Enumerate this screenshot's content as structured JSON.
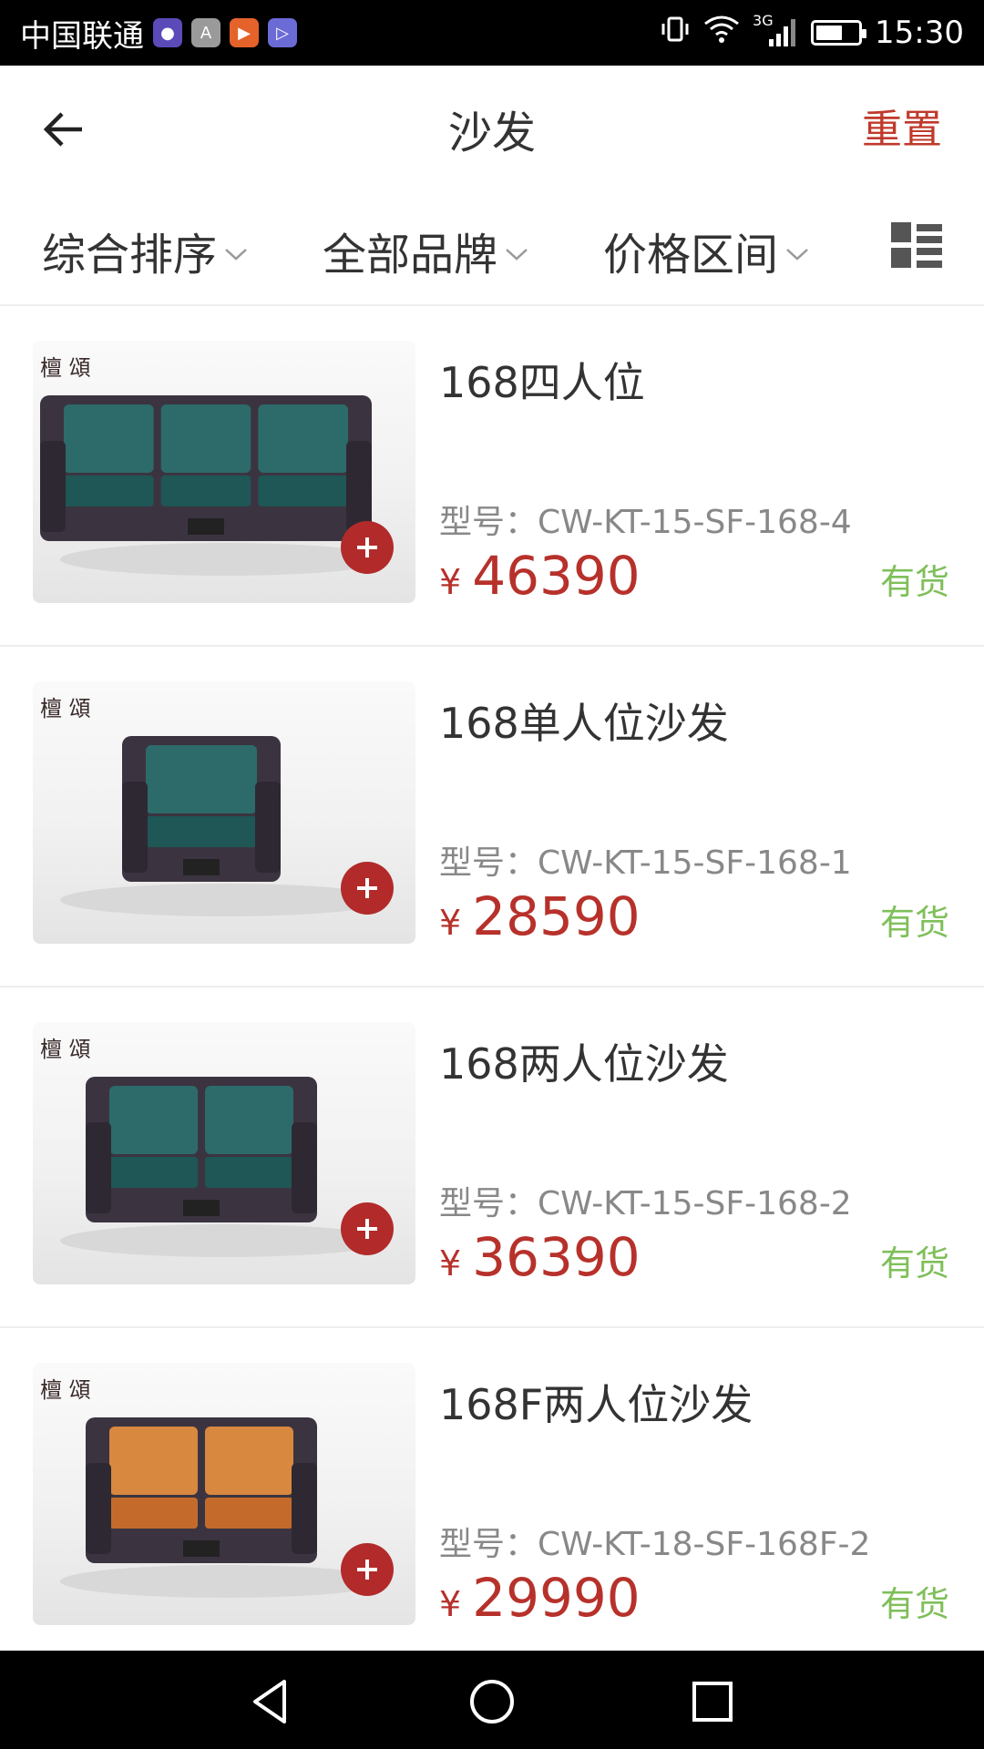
{
  "status_bar": {
    "carrier": "中国联通",
    "network": "3G",
    "time": "15:30",
    "badges": [
      "chat-app-icon",
      "text-app-icon",
      "video-app-icon",
      "play-app-icon"
    ]
  },
  "header": {
    "title": "沙发",
    "reset_label": "重置"
  },
  "filters": {
    "sort_label": "综合排序",
    "brand_label": "全部品牌",
    "price_label": "价格区间"
  },
  "colors": {
    "accent": "#b7312b",
    "stock": "#7fbf5a",
    "add_button": "#b22a2a"
  },
  "products": [
    {
      "name": "168四人位",
      "model": "型号：CW-KT-15-SF-168-4",
      "currency": "¥",
      "price": "46390",
      "stock": "有货",
      "color": "teal",
      "seats": 3
    },
    {
      "name": "168单人位沙发",
      "model": "型号：CW-KT-15-SF-168-1",
      "currency": "¥",
      "price": "28590",
      "stock": "有货",
      "color": "teal",
      "seats": 1
    },
    {
      "name": "168两人位沙发",
      "model": "型号：CW-KT-15-SF-168-2",
      "currency": "¥",
      "price": "36390",
      "stock": "有货",
      "color": "teal",
      "seats": 2
    },
    {
      "name": "168F两人位沙发",
      "model": "型号：CW-KT-18-SF-168F-2",
      "currency": "¥",
      "price": "29990",
      "stock": "有货",
      "color": "orange",
      "seats": 2
    }
  ]
}
